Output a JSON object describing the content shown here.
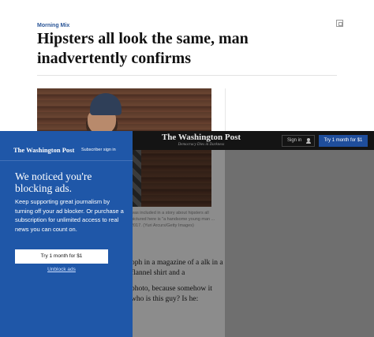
{
  "article": {
    "kicker": "Morning Mix",
    "headline": "Hipsters all look the same, man inadvertently confirms",
    "caption": "was included in a story about hipsters all pictured here is \"a handsome young man ... 2017. (Yuri Arcurs/Getty Images)",
    "body": [
      "oph in a magazine of a alk in a flannel shirt and a",
      "photo, because somehow it who is this guy? Is he:"
    ]
  },
  "topbar": {
    "masthead": "The Washington Post",
    "tagline": "Democracy Dies in Darkness",
    "signin_label": "Sign in",
    "try_label": "Try 1 month for $1"
  },
  "modal": {
    "logo": "The Washington Post",
    "signin_label": "Subscriber sign in",
    "title": "We noticed you're blocking ads.",
    "body": "Keep supporting great journalism by turning off your ad blocker. Or purchase a subscription for unlimited access to real news you can count on.",
    "try_label": "Try 1 month for $1",
    "unblock_label": "Unblock ads"
  },
  "colors": {
    "accent_blue": "#1f57a8",
    "kicker_blue": "#2a5597",
    "topbar": "#141414"
  }
}
